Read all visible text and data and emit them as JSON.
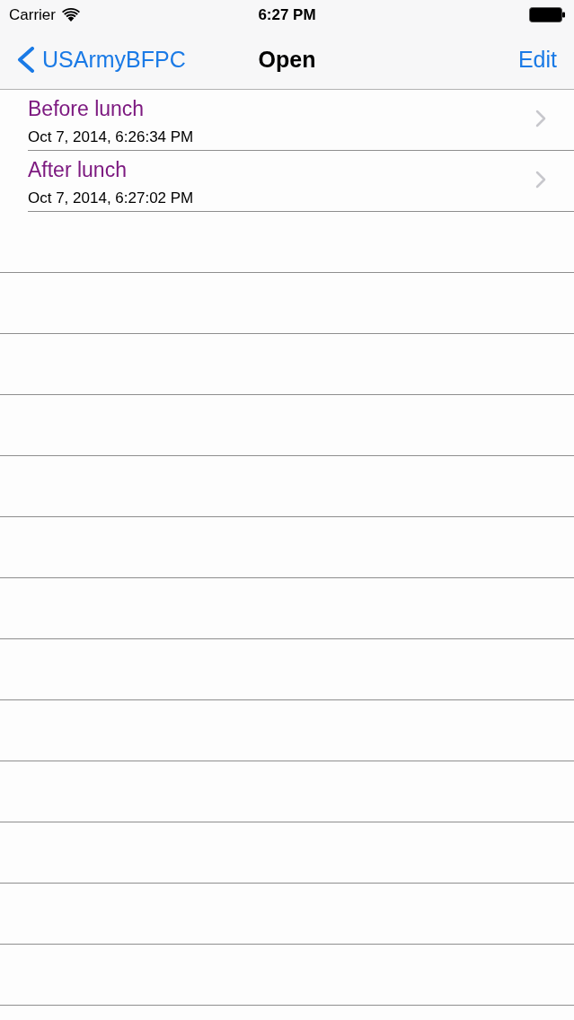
{
  "status_bar": {
    "carrier": "Carrier",
    "time": "6:27 PM"
  },
  "nav_bar": {
    "back_label": "USArmyBFPC",
    "title": "Open",
    "edit_label": "Edit"
  },
  "rows": [
    {
      "title": "Before lunch",
      "subtitle": "Oct 7, 2014, 6:26:34 PM"
    },
    {
      "title": "After lunch",
      "subtitle": "Oct 7, 2014, 6:27:02 PM"
    }
  ]
}
